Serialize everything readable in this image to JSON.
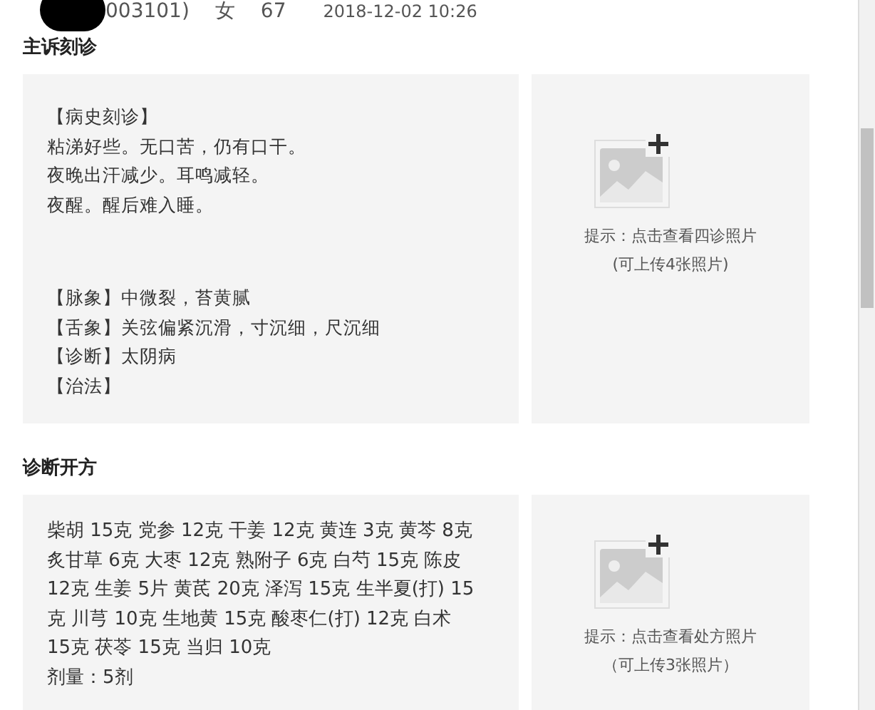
{
  "header": {
    "patient_id": "003101)",
    "gender": "女",
    "age": "67",
    "datetime": "2018-12-02 10:26"
  },
  "sections": [
    {
      "title": "主诉刻诊",
      "kind": "notes",
      "blocks": [
        [
          "【病史刻诊】",
          "粘涕好些。无口苦，仍有口干。",
          "夜晚出汗减少。耳鸣减轻。",
          "夜醒。醒后难入睡。"
        ],
        [
          "【脉象】中微裂，苔黄腻",
          "【舌象】关弦偏紧沉滑，寸沉细，尺沉细",
          "【诊断】太阴病",
          "【治法】"
        ]
      ],
      "hint": "提示：点击查看四诊照片",
      "hint_note": "(可上传4张照片)"
    },
    {
      "title": "诊断开方",
      "kind": "prescription",
      "blocks": [
        [
          "柴胡 15克 党参 12克 干姜 12克 黄连 3克 黄芩 8克",
          "炙甘草 6克 大枣 12克 熟附子 6克 白芍 15克 陈皮",
          "12克 生姜 5片 黄芪 20克 泽泻 15克 生半夏(打) 15",
          "克 川芎 10克 生地黄 15克 酸枣仁(打) 12克 白术",
          "15克 茯苓 15克 当归 10克",
          "剂量：5剂"
        ]
      ],
      "hint": "提示：点击查看处方照片",
      "hint_note": "（可上传3张照片）"
    }
  ]
}
